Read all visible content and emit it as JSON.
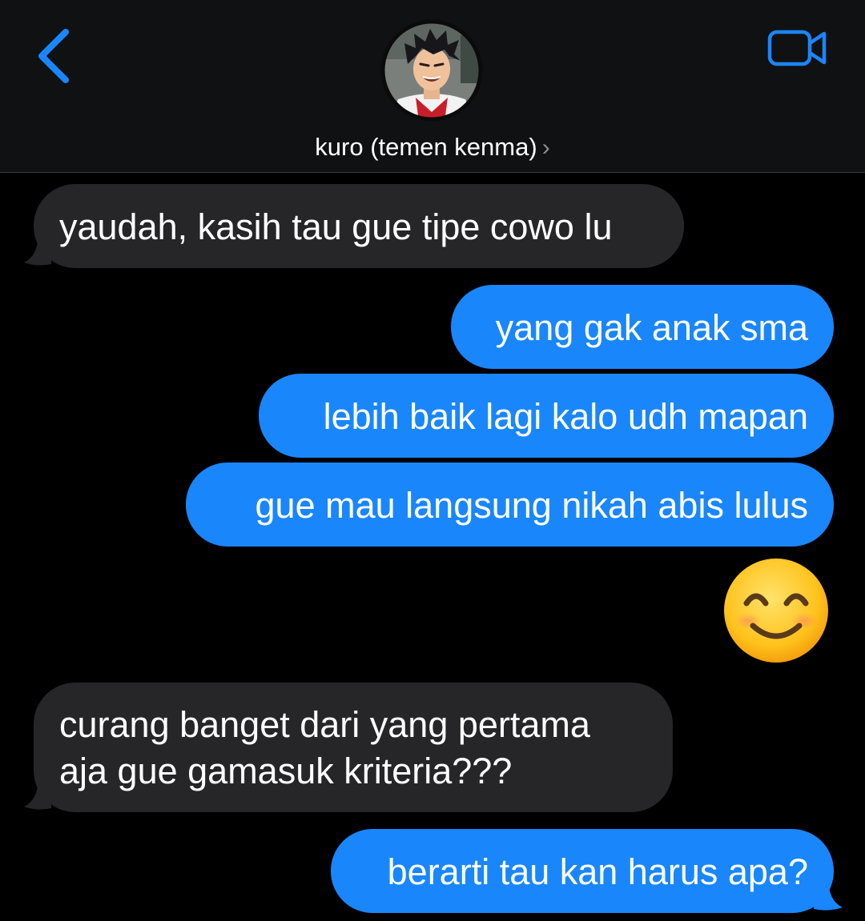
{
  "header": {
    "contact_name": "kuro (temen kenma)",
    "chevron": "›",
    "back_icon": "chevron-left-icon",
    "video_icon": "video-camera-icon",
    "accent_color": "#1a86fb"
  },
  "messages": [
    {
      "direction": "incoming",
      "text": "yaudah, kasih tau gue tipe cowo lu"
    },
    {
      "direction": "outgoing",
      "text": "yang gak anak sma"
    },
    {
      "direction": "outgoing",
      "text": "lebih baik lagi kalo udh mapan"
    },
    {
      "direction": "outgoing",
      "text": "gue mau langsung nikah abis lulus"
    },
    {
      "direction": "outgoing",
      "emoji": "smiling-face-with-smiling-eyes-emoji"
    },
    {
      "direction": "incoming",
      "lines": [
        "curang banget dari yang pertama",
        "aja gue gamasuk kriteria???"
      ]
    },
    {
      "direction": "outgoing",
      "text": "berarti tau kan harus apa?"
    }
  ]
}
